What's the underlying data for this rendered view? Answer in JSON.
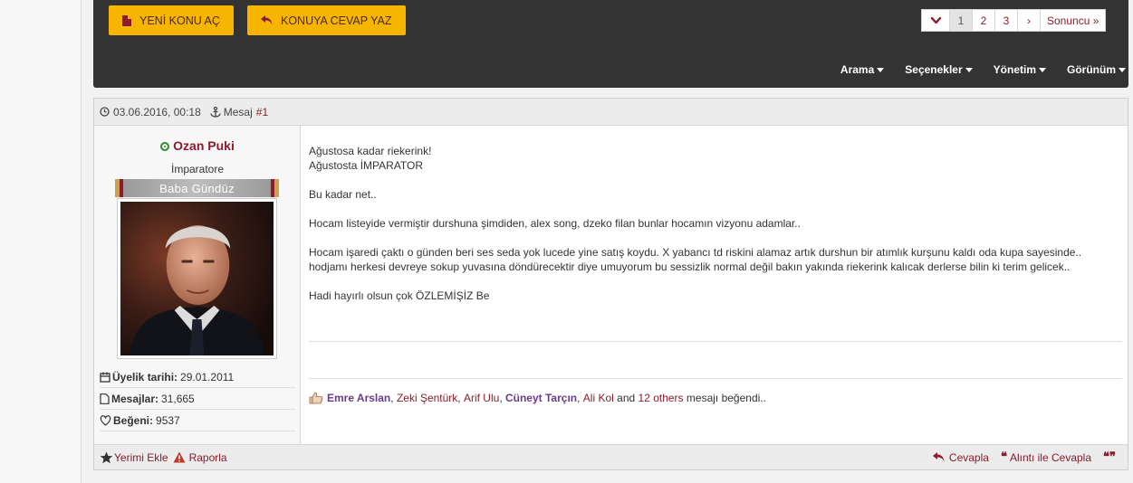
{
  "toolbar": {
    "new_topic": "YENİ KONU AÇ",
    "reply": "KONUYA CEVAP YAZ",
    "pages": [
      "1",
      "2",
      "3"
    ],
    "next": "›",
    "last": "Sonuncu »",
    "menus": [
      "Arama",
      "Seçenekler",
      "Yönetim",
      "Görünüm"
    ]
  },
  "post": {
    "date": "03.06.2016, 00:18",
    "mesaj_label": "Mesaj",
    "number": "#1",
    "user": {
      "name": "Ozan Puki",
      "rank": "İmparatore",
      "banner": "Baba Gündüz",
      "join_label": "Üyelik tarihi:",
      "join_value": "29.01.2011",
      "posts_label": "Mesajlar:",
      "posts_value": "31,665",
      "likes_label": "Beğeni:",
      "likes_value": "9537"
    },
    "body": {
      "l1": "Ağustosa kadar riekerink!",
      "l2": "Ağustosta İMPARATOR",
      "p2": "Bu kadar net..",
      "p3": "Hocam listeyide vermiştir durshuna şimdiden, alex song, dzeko filan bunlar hocamın vizyonu adamlar..",
      "p4": "Hocam işaredi çaktı o günden beri ses seda yok lucede yine satış koydu. X yabancı td riskini alamaz artık durshun bir atımlık kurşunu kaldı oda kupa sayesinde.. hodjamı herkesi devreye sokup yuvasına döndürecektir diye umuyorum bu sessizlik normal değil bakın yakında riekerink kalıcak derlerse bilin ki terim gelicek..",
      "p5": "Hadi hayırlı olsun çok ÖZLEMİŞİZ Be"
    },
    "likes": {
      "users": [
        "Emre Arslan",
        "Zeki Şentürk",
        "Arif Ulu",
        "Cüneyt Tarçın",
        "Ali Kol"
      ],
      "and": "and",
      "others": "12 others",
      "suffix": "mesajı beğendi.."
    },
    "footer": {
      "bookmark": "Yerimi Ekle",
      "report": "Raporla",
      "reply": "Cevapla",
      "quote_reply": "Alıntı ile Cevapla"
    }
  },
  "colors": {
    "accent": "#8a1c2b",
    "button": "#f7b500",
    "toolbar": "#333333"
  }
}
